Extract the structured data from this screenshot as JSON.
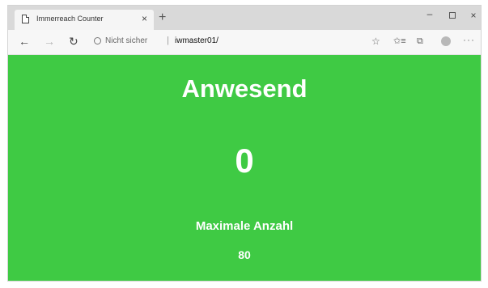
{
  "browser": {
    "tab": {
      "title": "Immerreach Counter",
      "close_glyph": "×"
    },
    "new_tab_glyph": "+",
    "window_controls": {
      "minimize": "–",
      "close": "×"
    },
    "nav": {
      "back": "←",
      "forward": "→",
      "refresh": "↻"
    },
    "address": {
      "security_text": "Nicht sicher",
      "separator": "|",
      "url": "iwmaster01/"
    },
    "toolbar_icons": {
      "star": "☆",
      "favorites": "✩≡",
      "collections": "⧉",
      "more": "···"
    }
  },
  "page": {
    "heading": "Anwesend",
    "count": "0",
    "max_label": "Maximale Anzahl",
    "max_value": "80",
    "background_color": "#3fca44",
    "text_color": "#ffffff"
  }
}
